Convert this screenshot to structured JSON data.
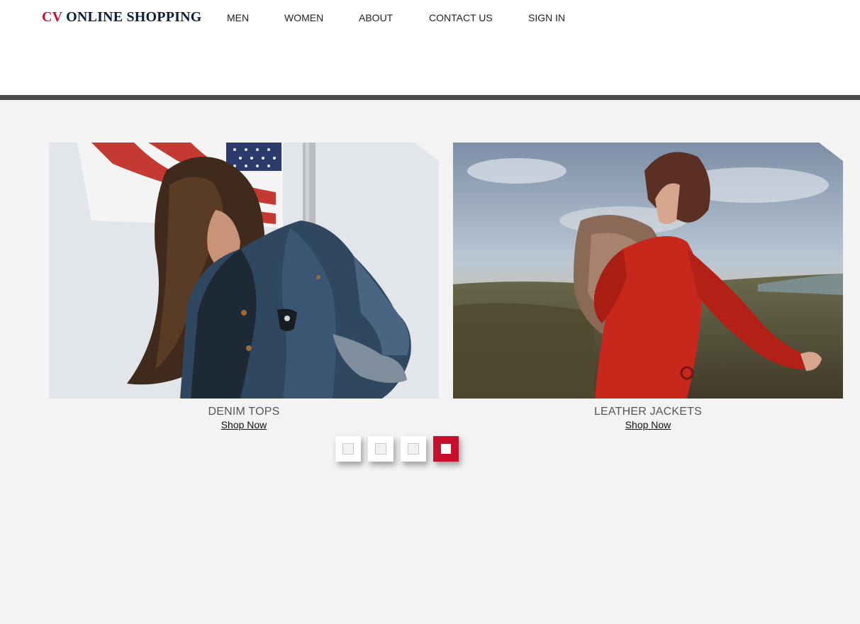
{
  "brand": {
    "cv": "CV",
    "rest": " ONLINE SHOPPING"
  },
  "nav": [
    {
      "label": "MEN"
    },
    {
      "label": "WOMEN"
    },
    {
      "label": "ABOUT"
    },
    {
      "label": "CONTACT US"
    },
    {
      "label": "SIGN IN"
    }
  ],
  "products": [
    {
      "title": "DENIM TOPS",
      "link": "Shop Now",
      "image": "woman-in-denim-jacket-photo"
    },
    {
      "title": "LEATHER JACKETS",
      "link": "Shop Now",
      "image": "woman-in-red-coat-photo"
    }
  ],
  "pager": {
    "pages": 4,
    "active_index": 3
  },
  "colors": {
    "accent": "#c8102e",
    "brand_dark": "#0d1b3e",
    "divider": "#4a4a4a",
    "background": "#f3f3f3"
  }
}
